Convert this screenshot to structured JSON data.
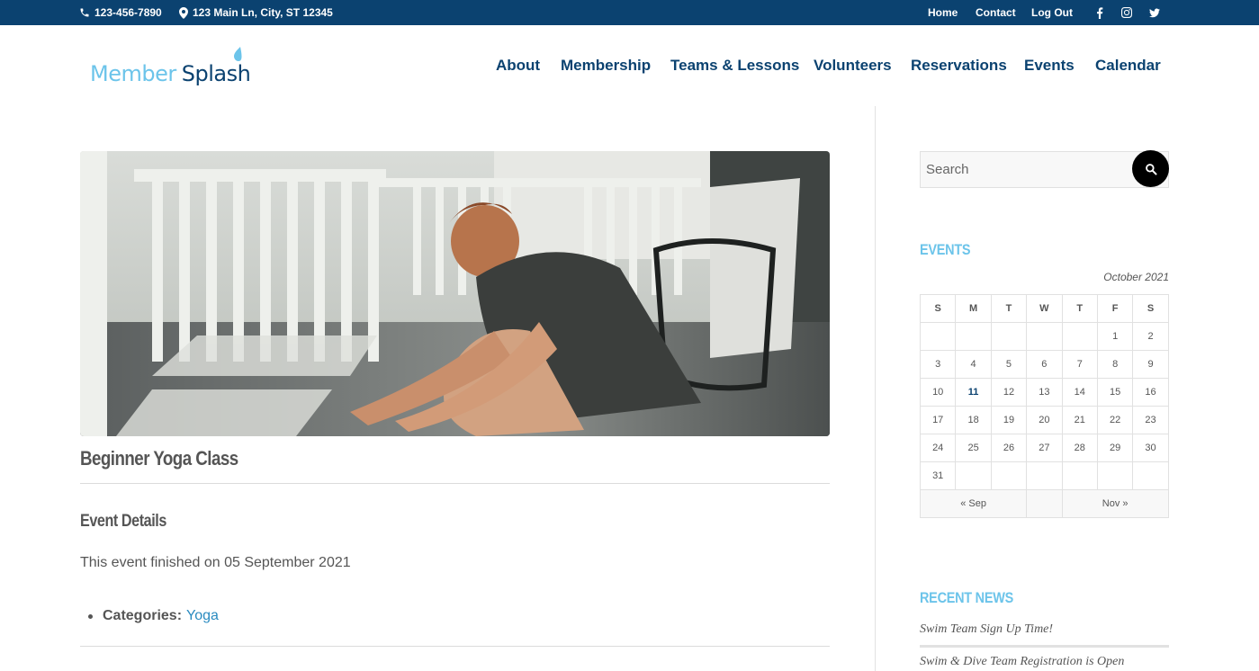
{
  "topbar": {
    "phone": "123-456-7890",
    "address": "123 Main Ln, City, ST 12345",
    "links": [
      "Home",
      "Contact",
      "Log Out"
    ],
    "social_icons": [
      "facebook-icon",
      "instagram-icon",
      "twitter-icon"
    ]
  },
  "brand": {
    "logo_part1": "Member",
    "logo_part2": "Splash"
  },
  "nav": [
    "About",
    "Membership",
    "Teams & Lessons",
    "Volunteers",
    "Reservations",
    "Events",
    "Calendar"
  ],
  "event": {
    "title": "Beginner Yoga Class",
    "details_heading": "Event Details",
    "finished_text": "This event finished on 05 September 2021",
    "categories_label": "Categories:",
    "category": "Yoga"
  },
  "sidebar": {
    "search_placeholder": "Search",
    "events_title": "EVENTS",
    "calendar": {
      "caption": "October 2021",
      "weekdays": [
        "S",
        "M",
        "T",
        "W",
        "T",
        "F",
        "S"
      ],
      "weeks": [
        [
          "",
          "",
          "",
          "",
          "",
          "1",
          "2"
        ],
        [
          "3",
          "4",
          "5",
          "6",
          "7",
          "8",
          "9"
        ],
        [
          "10",
          "11",
          "12",
          "13",
          "14",
          "15",
          "16"
        ],
        [
          "17",
          "18",
          "19",
          "20",
          "21",
          "22",
          "23"
        ],
        [
          "24",
          "25",
          "26",
          "27",
          "28",
          "29",
          "30"
        ],
        [
          "31",
          "",
          "",
          "",
          "",
          "",
          ""
        ]
      ],
      "today": "11",
      "prev": "« Sep",
      "next": "Nov »"
    },
    "news_title": "RECENT NEWS",
    "news": [
      "Swim Team Sign Up Time!",
      "Swim & Dive Team Registration is Open"
    ]
  },
  "colors": {
    "topbar_bg": "#0b4270",
    "nav_text": "#0b4270",
    "accent_light": "#6cc4ea",
    "link": "#2a8bc0"
  }
}
